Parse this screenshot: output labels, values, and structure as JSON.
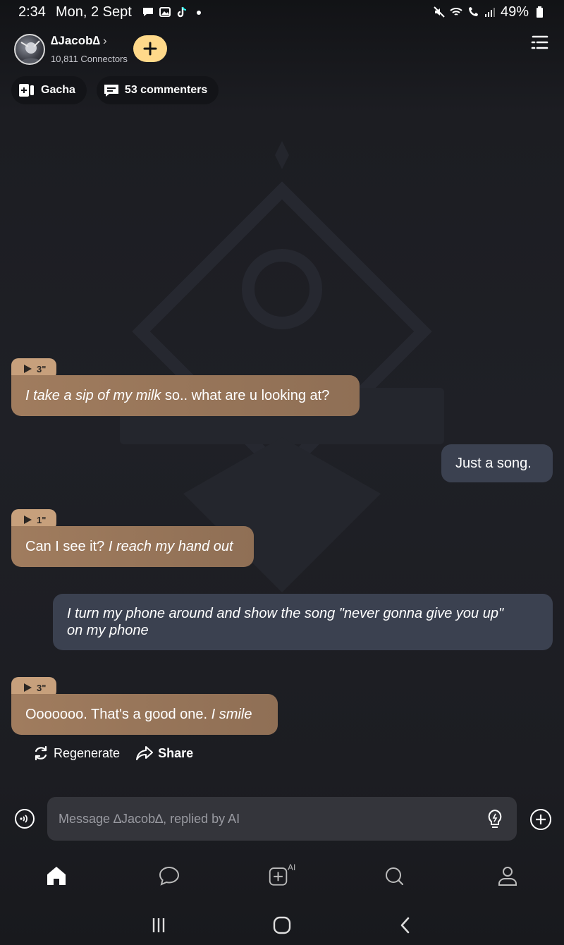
{
  "status_bar": {
    "time": "2:34",
    "date": "Mon, 2 Sept",
    "battery": "49%"
  },
  "header": {
    "name": "∆Jacob∆",
    "connectors": "10,811 Connectors"
  },
  "chips": {
    "gacha": "Gacha",
    "commenters": "53 commenters"
  },
  "messages": [
    {
      "role": "ai",
      "duration": "3\"",
      "italic": "I take a sip of my milk",
      "text": " so.. what are u looking at?"
    },
    {
      "role": "user",
      "text": "Just a song."
    },
    {
      "role": "ai",
      "duration": "1\"",
      "text": "Can I see it? ",
      "italic": "I reach my hand out"
    },
    {
      "role": "user",
      "italic_line1": "I turn my phone around and show the song \"never gonna give you up\"",
      "italic_line2": "on my phone"
    },
    {
      "role": "ai",
      "duration": "3\"",
      "text": "Ooooooo. That's a good one. ",
      "italic": "I smile"
    }
  ],
  "actions": {
    "regenerate": "Regenerate",
    "share": "Share"
  },
  "composer": {
    "placeholder": "Message ∆Jacob∆, replied by AI"
  },
  "bottom_nav": {
    "ai_badge": "AI"
  },
  "colors": {
    "ai_bubble": "#a07c5e",
    "user_bubble": "#3b4150",
    "follow_button": "#ffd98a"
  }
}
